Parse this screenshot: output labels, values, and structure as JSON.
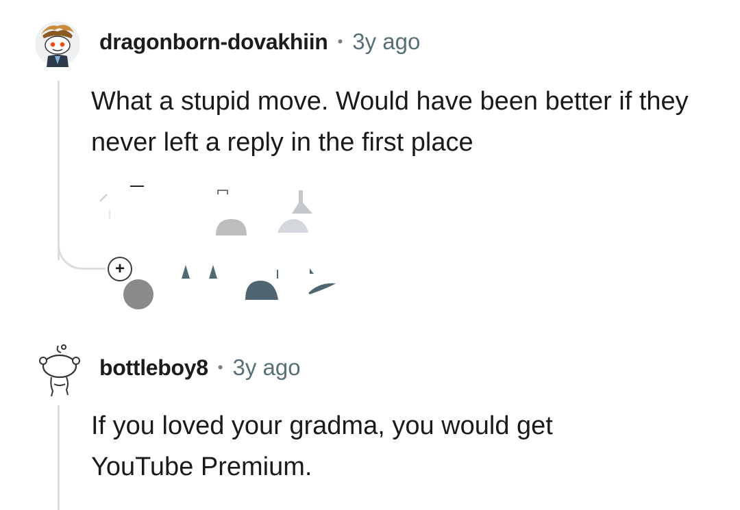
{
  "comments": [
    {
      "username": "dragonborn-dovakhiin",
      "separator": "•",
      "age": "3y ago",
      "body": "What a stupid move. Would have been better if they never left a reply in the first place",
      "avatar_icon": "snoo-avatar-icon"
    },
    {
      "username": "bottleboy8",
      "separator": "•",
      "age": "3y ago",
      "body": "If you loved your gradma, you would get YouTube Premium.",
      "avatar_icon": "snoo-outline-avatar-icon"
    }
  ],
  "thread": {
    "expand_symbol": "+"
  },
  "colors": {
    "thread_line": "#dcdcdc",
    "username": "#1c1c1c",
    "age": "#576f76",
    "body": "#1a1a1b"
  }
}
